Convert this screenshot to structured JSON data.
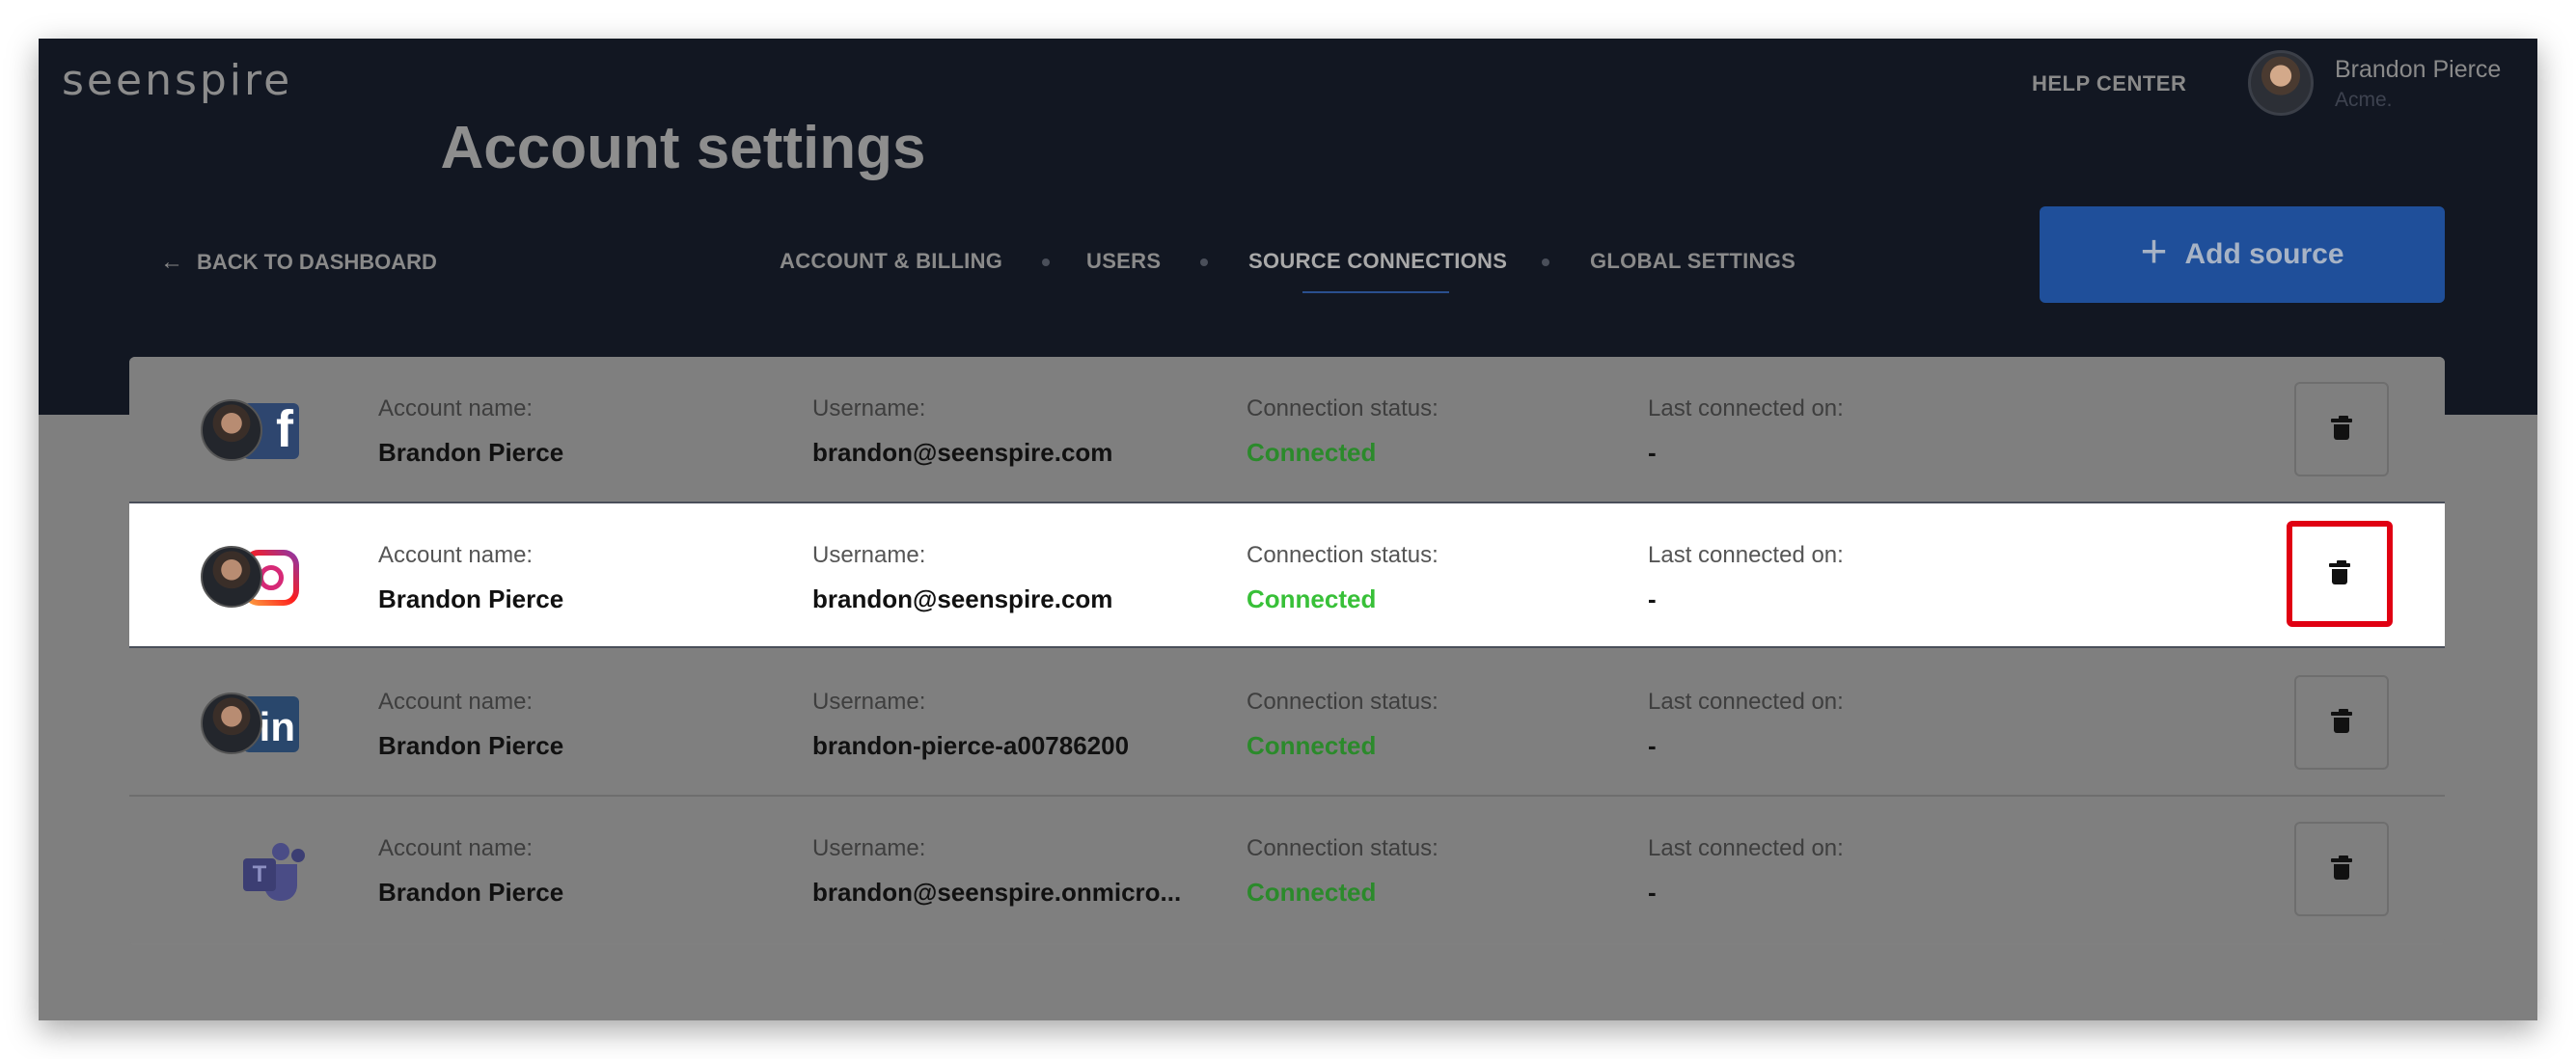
{
  "app": {
    "logo": "seenspire"
  },
  "header": {
    "help_center": "HELP CENTER",
    "user": {
      "name": "Brandon Pierce",
      "org": "Acme."
    },
    "title": "Account settings",
    "back_label": "BACK TO DASHBOARD",
    "tabs": [
      {
        "label": "ACCOUNT & BILLING",
        "active": false
      },
      {
        "label": "USERS",
        "active": false
      },
      {
        "label": "SOURCE CONNECTIONS",
        "active": true
      },
      {
        "label": "GLOBAL SETTINGS",
        "active": false
      }
    ],
    "add_source_label": "Add source"
  },
  "labels": {
    "account_name": "Account name:",
    "username": "Username:",
    "connection_status": "Connection status:",
    "last_connected": "Last connected on:"
  },
  "connections": [
    {
      "network": "facebook-icon",
      "account_name": "Brandon Pierce",
      "username": "brandon@seenspire.com",
      "status": "Connected",
      "last_connected": "-"
    },
    {
      "network": "instagram-icon",
      "account_name": "Brandon Pierce",
      "username": "brandon@seenspire.com",
      "status": "Connected",
      "last_connected": "-",
      "highlighted": true
    },
    {
      "network": "linkedin-icon",
      "account_name": "Brandon Pierce",
      "username": "brandon-pierce-a00786200",
      "status": "Connected",
      "last_connected": "-"
    },
    {
      "network": "teams-icon",
      "account_name": "Brandon Pierce",
      "username": "brandon@seenspire.onmicro...",
      "status": "Connected",
      "last_connected": "-"
    }
  ],
  "colors": {
    "header_bg": "#121722",
    "accent_blue": "#1f4f9a",
    "status_green": "#38c038",
    "highlight_red": "#e00012"
  }
}
